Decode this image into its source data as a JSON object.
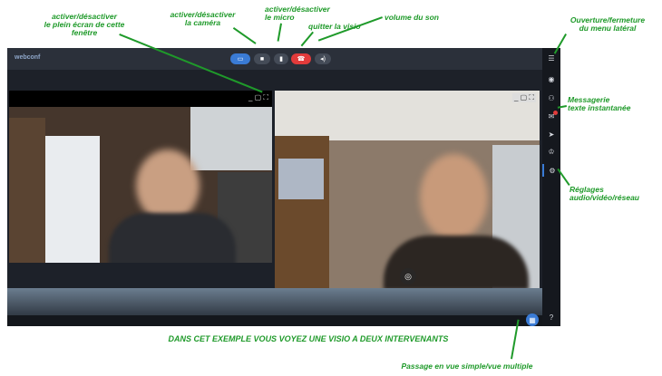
{
  "annotations": {
    "fullscreen": "activer/désactiver\nle plein écran de cette\nfenêtre",
    "camera": "activer/désactiver\nla caméra",
    "micro": "activer/désactiver\nle micro",
    "quit": "quitter la visio",
    "volume": "volume du son",
    "menu": "Ouverture/fermeture\ndu menu latéral",
    "chat": "Messagerie\ntexte instantanée",
    "settings": "Réglages\naudio/vidéo/réseau",
    "example": "DANS CET EXEMPLE VOUS VOYEZ UNE VISIO A DEUX INTERVENANTS",
    "view": "Passage en vue simple/vue multiple"
  },
  "app": {
    "logo": "webconf"
  },
  "colors": {
    "annotation": "#1f9a2a",
    "hangup": "#e23b3b",
    "share": "#3a7bd5"
  },
  "sidebar_icons": [
    "menu-icon",
    "user-icon",
    "participants-icon",
    "chat-icon",
    "send-icon",
    "crown-icon",
    "gear-icon",
    "help-icon"
  ]
}
